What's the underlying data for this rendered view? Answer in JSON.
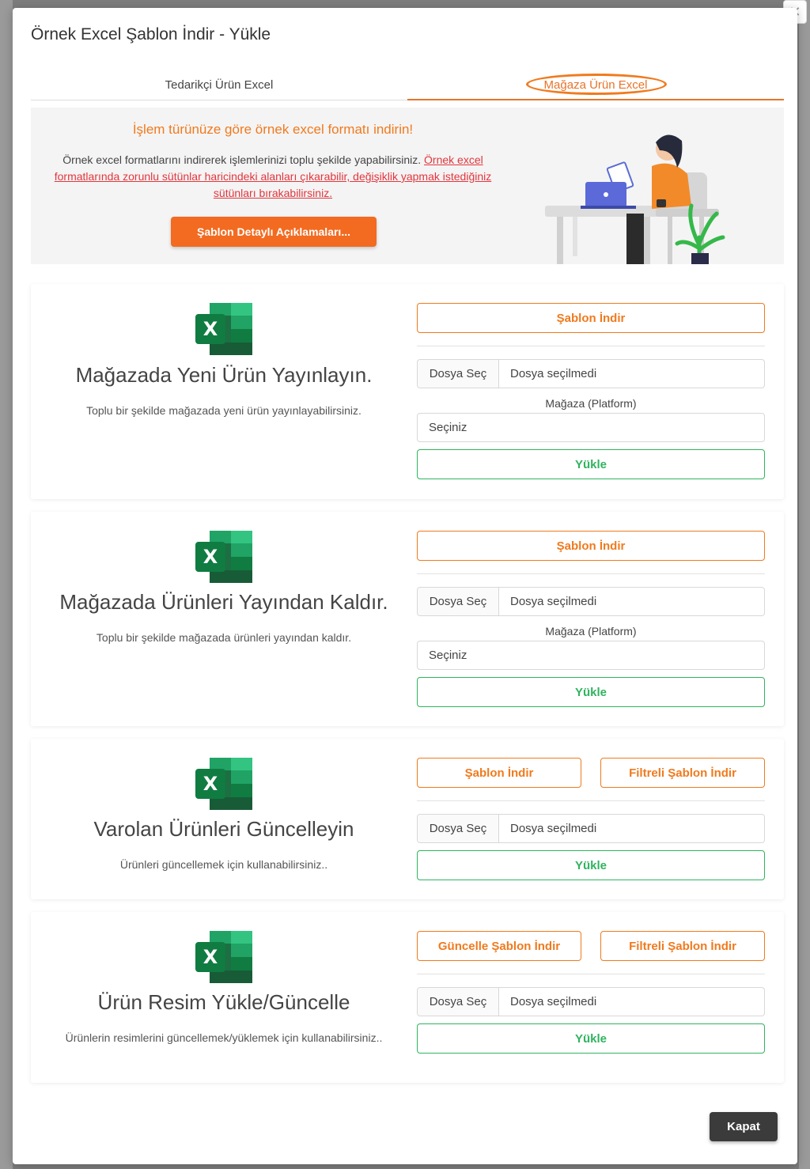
{
  "modal": {
    "title": "Örnek Excel Şablon İndir - Yükle",
    "close_icon": "close-icon",
    "close_button": "Kapat"
  },
  "tabs": [
    {
      "label": "Tedarikçi Ürün Excel",
      "active": false
    },
    {
      "label": "Mağaza Ürün Excel",
      "active": true
    }
  ],
  "banner": {
    "heading": "İşlem türünüze göre örnek excel formatı indirin!",
    "text": "Örnek excel formatlarını indirerek işlemlerinizi toplu şekilde yapabilirsiniz. ",
    "link": "Örnek excel formatlarında zorunlu sütünlar haricindeki alanları çıkarabilir, değişiklik yapmak istediğiniz sütünları bırakabilirsiniz.",
    "button": "Şablon Detaylı Açıklamaları..."
  },
  "cards": [
    {
      "title": "Mağazada Yeni Ürün Yayınlayın.",
      "desc": "Toplu bir şekilde mağazada yeni ürün yayınlayabilirsiniz.",
      "download_button": "Şablon İndir",
      "file_choose": "Dosya Seç",
      "file_none": "Dosya seçilmedi",
      "platform_label": "Mağaza (Platform)",
      "select_placeholder": "Seçiniz",
      "upload_button": "Yükle"
    },
    {
      "title": "Mağazada Ürünleri Yayından Kaldır.",
      "desc": "Toplu bir şekilde mağazada ürünleri yayından kaldır.",
      "download_button": "Şablon İndir",
      "file_choose": "Dosya Seç",
      "file_none": "Dosya seçilmedi",
      "platform_label": "Mağaza (Platform)",
      "select_placeholder": "Seçiniz",
      "upload_button": "Yükle"
    },
    {
      "title": "Varolan Ürünleri Güncelleyin",
      "desc": "Ürünleri güncellemek için kullanabilirsiniz..",
      "download_button": "Şablon İndir",
      "filtered_button": "Filtreli Şablon İndir",
      "file_choose": "Dosya Seç",
      "file_none": "Dosya seçilmedi",
      "upload_button": "Yükle"
    },
    {
      "title": "Ürün Resim Yükle/Güncelle",
      "desc": "Ürünlerin resimlerini güncellemek/yüklemek için kullanabilirsiniz..",
      "download_button": "Güncelle Şablon İndir",
      "filtered_button": "Filtreli Şablon İndir",
      "file_choose": "Dosya Seç",
      "file_none": "Dosya seçilmedi",
      "upload_button": "Yükle"
    }
  ],
  "colors": {
    "accent": "#f07a1e",
    "success": "#2fb45e",
    "link": "#e2363d",
    "dark_button": "#3b3b3b"
  }
}
